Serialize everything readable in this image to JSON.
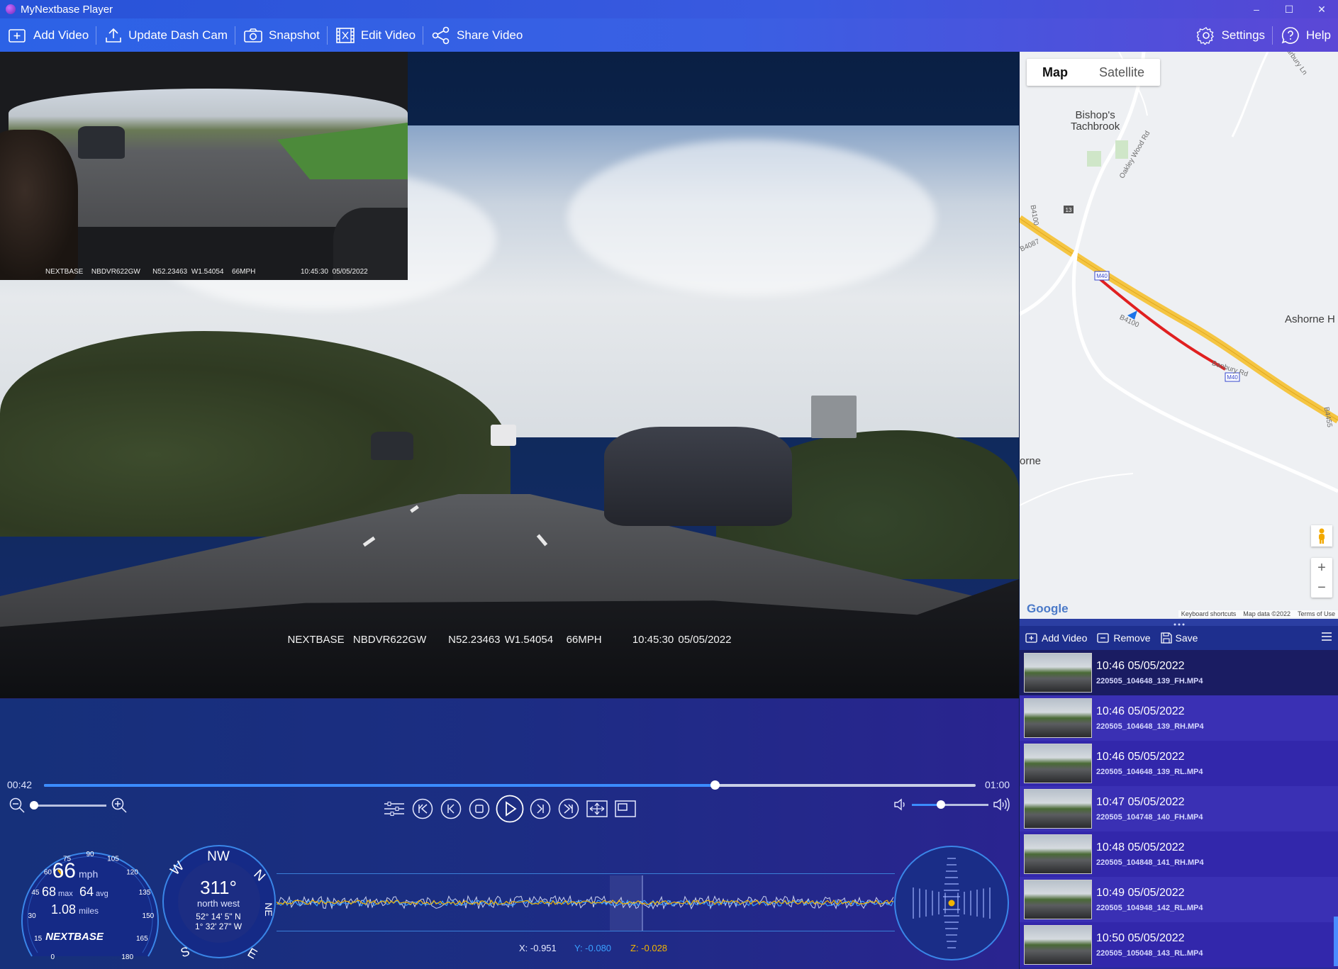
{
  "window": {
    "title": "MyNextbase Player",
    "controls": [
      "–",
      "☐",
      "✕"
    ]
  },
  "toolbar": {
    "add_video": "Add Video",
    "update_dash_cam": "Update Dash Cam",
    "snapshot": "Snapshot",
    "edit_video": "Edit Video",
    "share_video": "Share Video",
    "settings": "Settings",
    "help": "Help"
  },
  "video": {
    "main_overlay": {
      "brand": "NEXTBASE",
      "model": "NBDVR622GW",
      "coords": "N52.23463 W1.54054",
      "speed": "66MPH",
      "datetime": "10:45:30 05/05/2022"
    },
    "rear_overlay": {
      "brand": "NEXTBASE",
      "model": "NBDVR622GW",
      "coords": "N52.23463 W1.54054",
      "speed": "66MPH",
      "datetime": "10:45:30 05/05/2022"
    }
  },
  "playback": {
    "current_time": "00:42",
    "total_time": "01:00",
    "progress": 0.72,
    "zoom_level": 0.0,
    "volume": 0.38
  },
  "speedometer": {
    "speed": "66",
    "unit": "mph",
    "max": "68",
    "max_label": "max",
    "avg": "64",
    "avg_label": "avg",
    "distance": "1.08",
    "distance_unit": "miles",
    "ticks": [
      "0",
      "15",
      "30",
      "45",
      "60",
      "75",
      "90",
      "105",
      "120",
      "135",
      "150",
      "165",
      "180"
    ],
    "logo": "NEXTBASE"
  },
  "compass": {
    "heading": "311°",
    "direction": "north west",
    "lat": "52° 14' 5\" N",
    "lon": "1° 32' 27\" W",
    "labels": [
      "W",
      "NW",
      "N",
      "NE",
      "S",
      "E"
    ]
  },
  "gsensor": {
    "x": "X: -0.951",
    "y": "Y: -0.080",
    "z": "Z: -0.028",
    "x_color": "#e6e9ff",
    "y_color": "#3aa0ff",
    "z_color": "#f2b400"
  },
  "map": {
    "tab_map": "Map",
    "tab_satellite": "Satellite",
    "places": {
      "bishops_line1": "Bishop's",
      "bishops_line2": "Tachbrook",
      "ashorne": "Ashorne H",
      "orne": "orne"
    },
    "roads": {
      "oakley": "Oakley Wood Rd",
      "b4100_a": "B4100",
      "b4087": "B4087",
      "b4100_b": "B4100",
      "banbury": "Banbury Rd",
      "harbury": "Harbury Ln",
      "b4455": "B4455",
      "j13": "13",
      "m40_a": "M40",
      "m40_b": "M40"
    },
    "zoom_in": "+",
    "zoom_out": "−",
    "google": "Google",
    "footer": {
      "shortcuts": "Keyboard shortcuts",
      "data": "Map data ©2022",
      "terms": "Terms of Use"
    },
    "route_color": "#e02020",
    "motorway_color": "#f5c542"
  },
  "playlist": {
    "add_video": "Add Video",
    "remove": "Remove",
    "save": "Save",
    "items": [
      {
        "time": "10:46 05/05/2022",
        "file": "220505_104648_139_FH.MP4"
      },
      {
        "time": "10:46 05/05/2022",
        "file": "220505_104648_139_RH.MP4"
      },
      {
        "time": "10:46 05/05/2022",
        "file": "220505_104648_139_RL.MP4"
      },
      {
        "time": "10:47 05/05/2022",
        "file": "220505_104748_140_FH.MP4"
      },
      {
        "time": "10:48 05/05/2022",
        "file": "220505_104848_141_RH.MP4"
      },
      {
        "time": "10:49 05/05/2022",
        "file": "220505_104948_142_RL.MP4"
      },
      {
        "time": "10:50 05/05/2022",
        "file": "220505_105048_143_RL.MP4"
      }
    ]
  }
}
